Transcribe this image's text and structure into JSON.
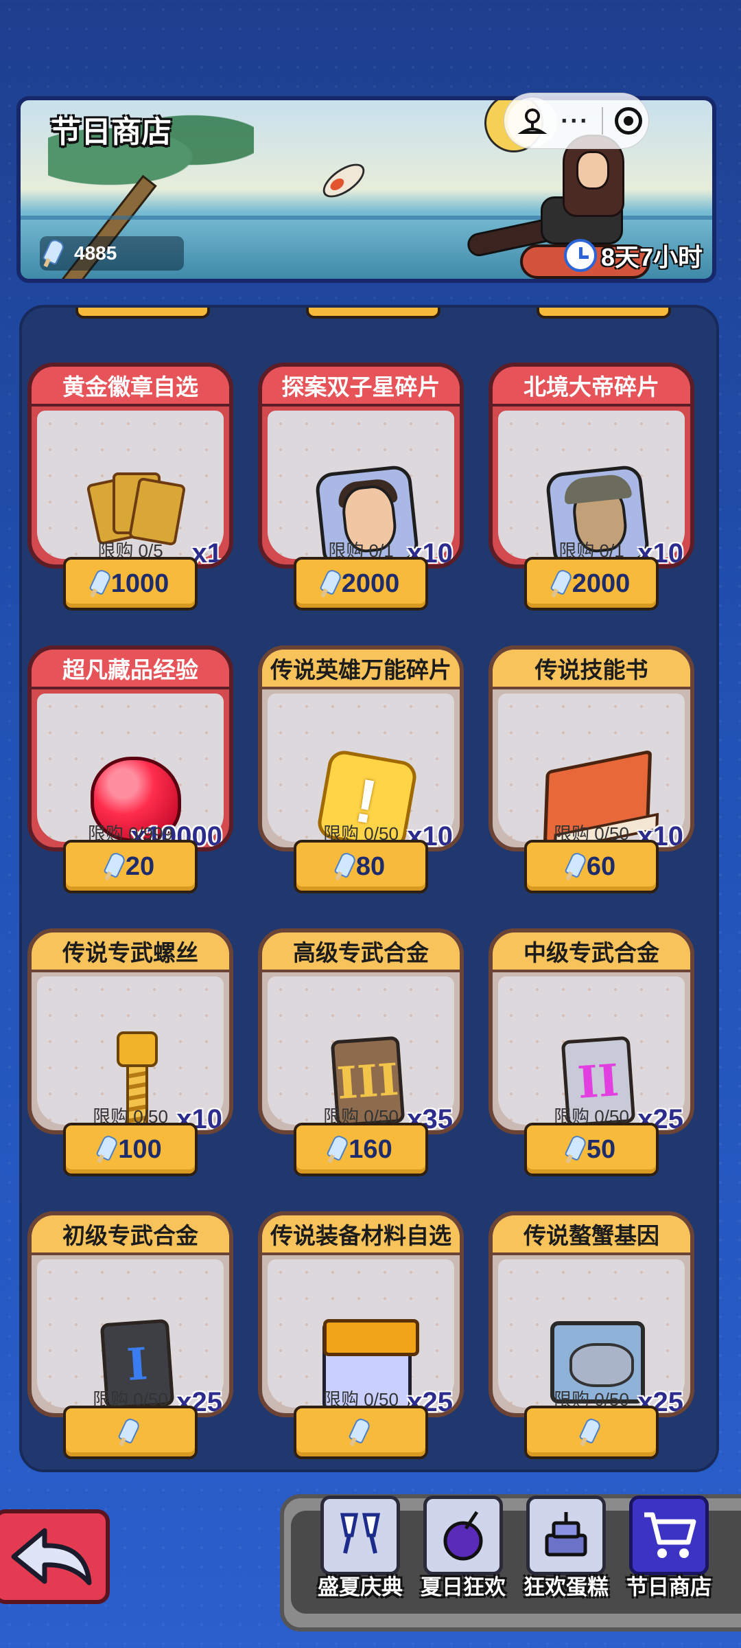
{
  "header": {
    "title": "节日商店",
    "currency_value": "4885",
    "timer": "8天7小时",
    "icons": {
      "currency": "popsicle-icon",
      "timer": "clock-icon"
    }
  },
  "system": {
    "menu_dots": "···"
  },
  "items": [
    {
      "name": "黄金徽章自选",
      "qty": "x1",
      "limit": "限购 0/5",
      "price": "1000",
      "style": "red",
      "art": "badge-stack"
    },
    {
      "name": "探案双子星碎片",
      "qty": "x10",
      "limit": "限购 0/1",
      "price": "2000",
      "style": "red",
      "art": "puzzle-detective"
    },
    {
      "name": "北境大帝碎片",
      "qty": "x10",
      "limit": "限购 0/1",
      "price": "2000",
      "style": "red",
      "art": "puzzle-old-man"
    },
    {
      "name": "超凡藏品经验",
      "qty": "x10000",
      "limit": "限购 0/999",
      "price": "20",
      "style": "red",
      "art": "red-gem"
    },
    {
      "name": "传说英雄万能碎片",
      "qty": "x10",
      "limit": "限购 0/50",
      "price": "80",
      "style": "gold",
      "art": "gold-puzzle"
    },
    {
      "name": "传说技能书",
      "qty": "x10",
      "limit": "限购 0/50",
      "price": "60",
      "style": "gold",
      "art": "skill-book"
    },
    {
      "name": "传说专武螺丝",
      "qty": "x10",
      "limit": "限购 0/50",
      "price": "100",
      "style": "gold",
      "art": "screw"
    },
    {
      "name": "高级专武合金",
      "qty": "x35",
      "limit": "限购 0/50",
      "price": "160",
      "style": "gold",
      "art": "tablet-iii"
    },
    {
      "name": "中级专武合金",
      "qty": "x25",
      "limit": "限购 0/50",
      "price": "50",
      "style": "gold",
      "art": "tablet-ii"
    },
    {
      "name": "初级专武合金",
      "qty": "x25",
      "limit": "限购 0/50",
      "price": "",
      "style": "gold",
      "art": "tablet-i"
    },
    {
      "name": "传说装备材料自选",
      "qty": "x25",
      "limit": "限购 0/50",
      "price": "",
      "style": "gold",
      "art": "chest"
    },
    {
      "name": "传说螯蟹基因",
      "qty": "x25",
      "limit": "限购 0/50",
      "price": "",
      "style": "gold",
      "art": "tv-crab"
    }
  ],
  "nav": {
    "back": "back-arrow-icon",
    "tabs": [
      {
        "label": "盛夏庆典",
        "icon": "cheers-glasses-icon"
      },
      {
        "label": "夏日狂欢",
        "icon": "coconut-drink-icon"
      },
      {
        "label": "狂欢蛋糕",
        "icon": "cake-icon"
      },
      {
        "label": "节日商店",
        "icon": "shopping-cart-icon",
        "active": true
      }
    ]
  },
  "colors": {
    "accent_gold": "#f8ba3a",
    "accent_red": "#e6545a",
    "panel": "#21386f"
  }
}
